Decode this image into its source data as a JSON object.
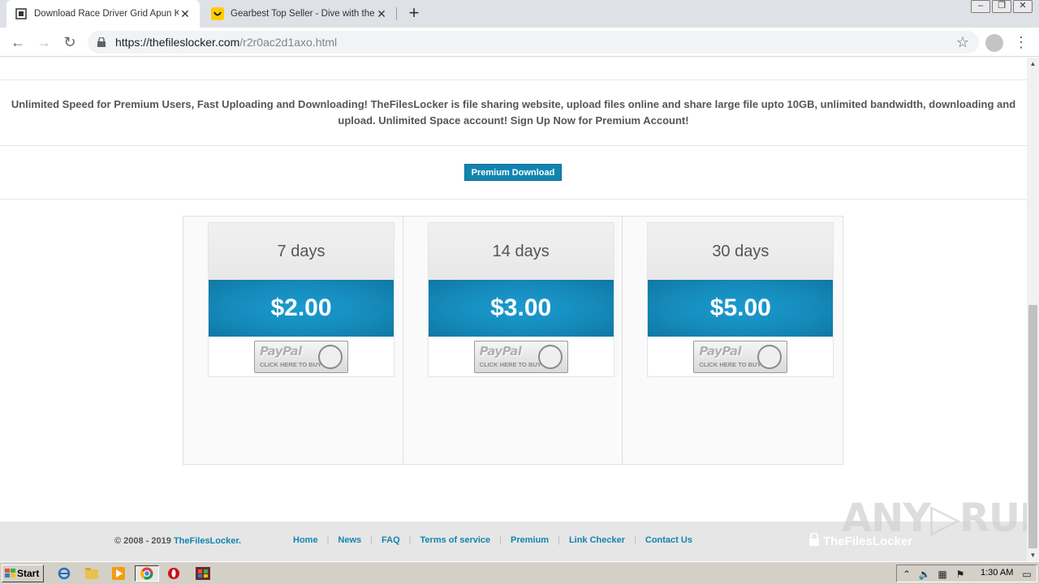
{
  "browser": {
    "tabs": [
      {
        "title": "Download Race Driver Grid Apun Ka",
        "active": true
      },
      {
        "title": "Gearbest Top Seller - Dive with the C",
        "active": false
      }
    ],
    "new_tab": "+",
    "url_host": "https://thefileslocker.com",
    "url_path": "/r2r0ac2d1axo.html",
    "window_buttons": [
      "–",
      "❐",
      "✕"
    ]
  },
  "page": {
    "promo_text": "Unlimited Speed for Premium Users, Fast Uploading and Downloading! TheFilesLocker is file sharing website, upload files online and share large file upto 10GB, unlimited bandwidth, downloading and upload. Unlimited Space account! Sign Up Now for Premium Account!",
    "premium_button": "Premium Download",
    "plans": [
      {
        "duration": "7 days",
        "price": "$2.00"
      },
      {
        "duration": "14 days",
        "price": "$3.00"
      },
      {
        "duration": "30 days",
        "price": "$5.00"
      }
    ],
    "paypal": {
      "logo": "PayPal",
      "subtitle": "CLICK HERE TO BUY"
    }
  },
  "footer": {
    "copyright_prefix": "© 2008 - 2019 ",
    "copyright_brand": "TheFilesLocker.",
    "links": [
      "Home",
      "News",
      "FAQ",
      "Terms of service",
      "Premium",
      "Link Checker",
      "Contact Us"
    ],
    "logo_text": "TheFilesLocker",
    "watermark": "ANY▷RUN"
  },
  "taskbar": {
    "start_label": "Start",
    "clock": "1:30 AM"
  }
}
